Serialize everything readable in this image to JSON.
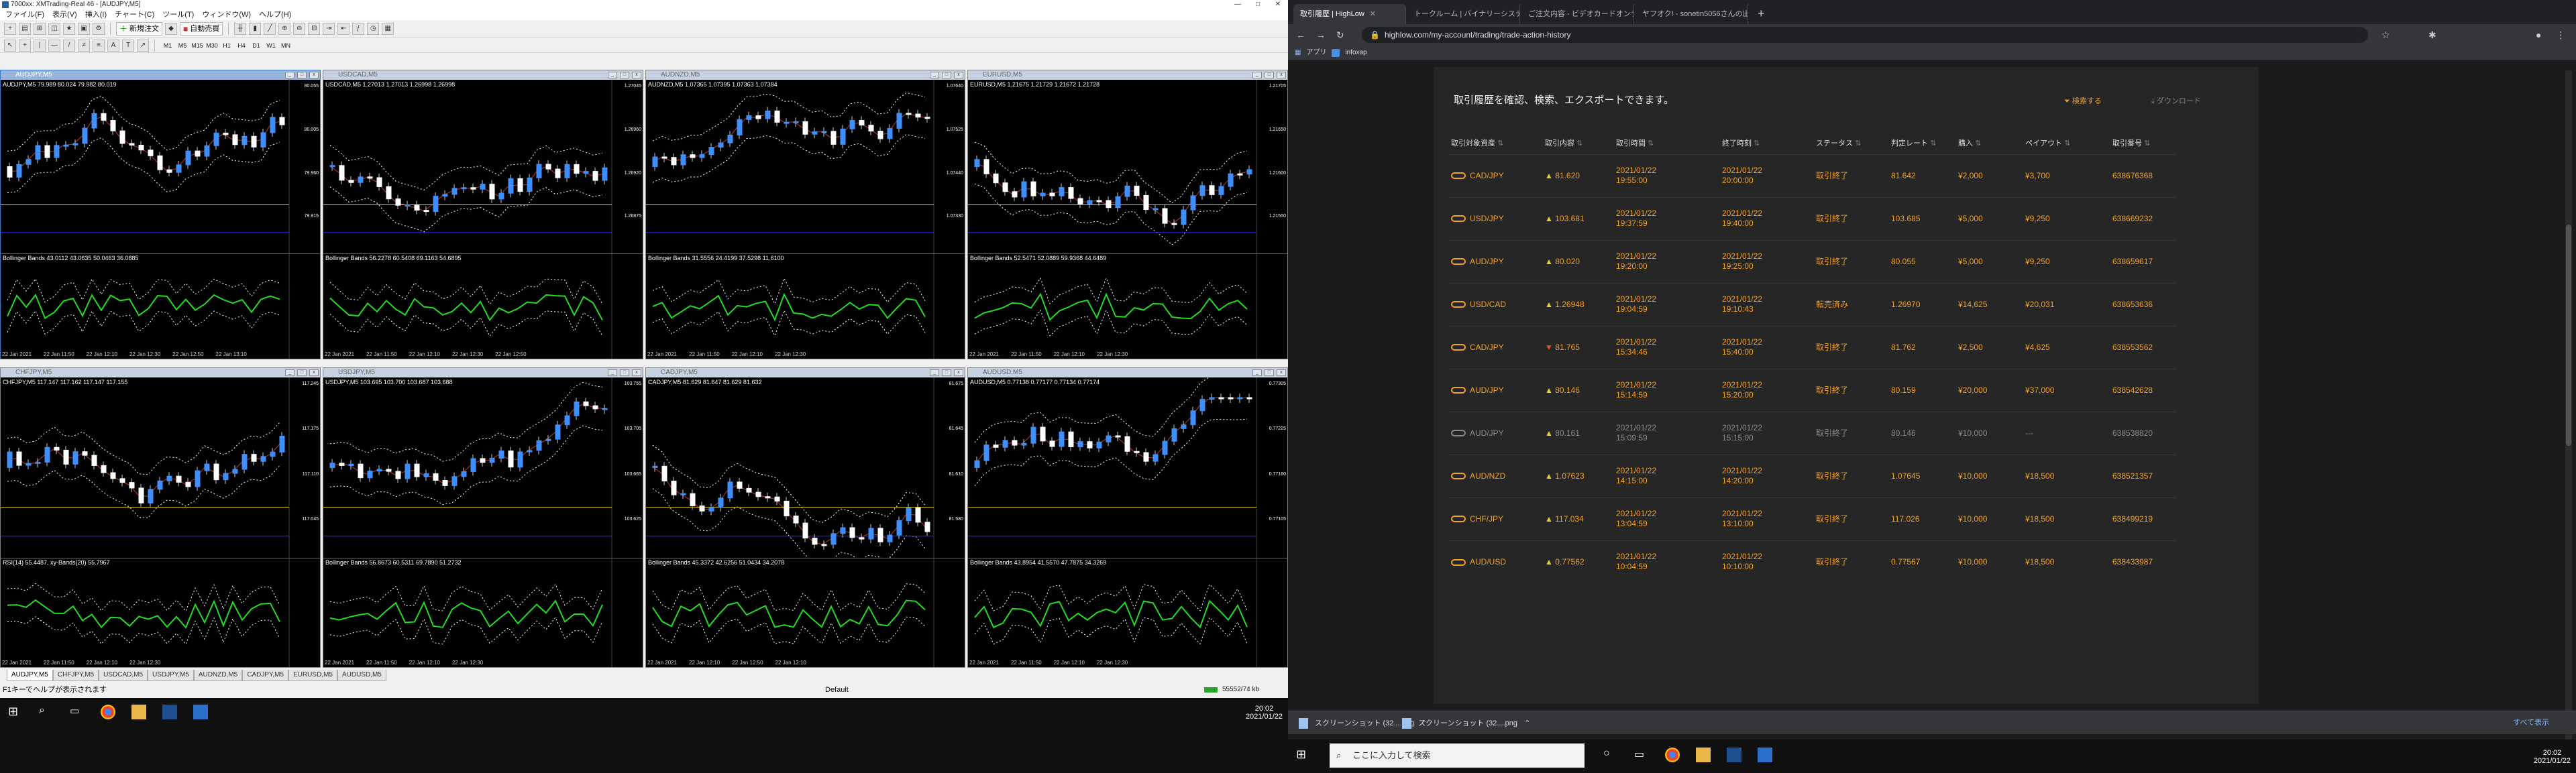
{
  "mt": {
    "title": "7000xx: XMTrading-Real 46 - [AUDJPY,M5]",
    "menu": [
      "ファイル(F)",
      "表示(V)",
      "挿入(I)",
      "チャート(C)",
      "ツール(T)",
      "ウィンドウ(W)",
      "ヘルプ(H)"
    ],
    "new_order": "新規注文",
    "auto_trade": "自動売買",
    "timeframes": [
      "M1",
      "M5",
      "M15",
      "M30",
      "H1",
      "H4",
      "D1",
      "W1",
      "MN"
    ],
    "status_left": "F1キーでヘルプが表示されます",
    "status_mid": "Default",
    "status_right": "55552/74 kb",
    "clock": [
      "20:02",
      "2021/01/22"
    ],
    "tabs": [
      "AUDJPY,M5",
      "CHFJPY,M5",
      "USDCAD,M5",
      "USDJPY,M5",
      "AUDNZD,M5",
      "CADJPY,M5",
      "EURUSD,M5",
      "AUDUSD,M5"
    ]
  },
  "charts": [
    {
      "title": "AUDJPY,M5",
      "info": "AUDJPY,M5  79.989 80.024 79.982 80.019",
      "sub": "Bollinger Bands 43.0112 43.0635 50.0463 36.0885",
      "prices": [
        "80.055",
        "80.005",
        "79.960",
        "79.915"
      ],
      "times": [
        "22 Jan 2021",
        "22 Jan 11:50",
        "22 Jan 12:10",
        "22 Jan 12:30",
        "22 Jan 12:50",
        "22 Jan 13:10"
      ]
    },
    {
      "title": "USDCAD,M5",
      "info": "USDCAD,M5  1.27013 1.27013 1.26998 1.26998",
      "sub": "Bollinger Bands 56.2278 60.5408 69.1163 54.6895",
      "prices": [
        "1.27045",
        "1.26960",
        "1.26920",
        "1.26875"
      ],
      "times": [
        "22 Jan 2021",
        "22 Jan 11:50",
        "22 Jan 12:10",
        "22 Jan 12:30",
        "22 Jan 12:50"
      ]
    },
    {
      "title": "AUDNZD,M5",
      "info": "AUDNZD,M5  1.07365 1.07395 1.07363 1.07384",
      "sub": "Bollinger Bands 31.5556 24.4199 37.5298 11.6100",
      "prices": [
        "1.07640",
        "1.07525",
        "1.07440",
        "1.07330"
      ],
      "times": [
        "22 Jan 2021",
        "22 Jan 11:50",
        "22 Jan 12:10",
        "22 Jan 12:30"
      ]
    },
    {
      "title": "EURUSD,M5",
      "info": "EURUSD,M5  1.21675 1.21729 1.21672 1.21728",
      "sub": "Bollinger Bands 52.5471 52.0889 59.9368 44.6489",
      "prices": [
        "1.21705",
        "1.21650",
        "1.21600",
        "1.21550"
      ],
      "times": [
        "22 Jan 2021",
        "22 Jan 11:50",
        "22 Jan 12:10",
        "22 Jan 12:30"
      ]
    },
    {
      "title": "CHFJPY,M5",
      "info": "CHFJPY,M5  117.147 117.162 117.147 117.155",
      "sub": "RSI(14) 55.4487, xy-Bands(20) 55.7967",
      "prices": [
        "117.245",
        "117.175",
        "117.110",
        "117.045"
      ],
      "times": [
        "22 Jan 2021",
        "22 Jan 11:50",
        "22 Jan 12:10",
        "22 Jan 12:30"
      ]
    },
    {
      "title": "USDJPY,M5",
      "info": "USDJPY,M5  103.695 103.700 103.687 103.688",
      "sub": "Bollinger Bands 56.8673 60.5311 69.7890 51.2732",
      "prices": [
        "103.755",
        "103.705",
        "103.665",
        "103.625"
      ],
      "times": [
        "22 Jan 2021",
        "22 Jan 11:50",
        "22 Jan 12:10",
        "22 Jan 12:30"
      ]
    },
    {
      "title": "CADJPY,M5",
      "info": "CADJPY,M5  81.629 81.647 81.629 81.632",
      "sub": "Bollinger Bands 45.3372 42.6256 51.0434 34.2078",
      "prices": [
        "81.675",
        "81.645",
        "81.610",
        "81.580"
      ],
      "times": [
        "22 Jan 2021",
        "22 Jan 12:10",
        "22 Jan 12:50",
        "22 Jan 13:10"
      ]
    },
    {
      "title": "AUDUSD,M5",
      "info": "AUDUSD,M5  0.77138 0.77177 0.77134 0.77174",
      "sub": "Bollinger Bands 43.8954 41.5570 47.7875 34.3269",
      "prices": [
        "0.77305",
        "0.77225",
        "0.77160",
        "0.77105"
      ],
      "times": [
        "22 Jan 2021",
        "22 Jan 11:50",
        "22 Jan 12:10",
        "22 Jan 12:30"
      ]
    }
  ],
  "browser": {
    "tabs": [
      "取引履歴 | HighLow",
      "トークルーム | バイナリーシステム改め",
      "ご注文内容 - ビデオカードオンライン",
      "ヤフオク! - sonetin5056さんの出品"
    ],
    "url": "highlow.com/my-account/trading/trade-action-history",
    "apps": "アプリ",
    "bookmark": "infoxap",
    "heading": "取引履歴を確認、検索、エクスポートできます。",
    "search_btn": "検索する",
    "download_btn": "ダウンロード",
    "columns": [
      "取引対象資産",
      "取引内容",
      "取引時間",
      "終了時刻",
      "ステータス",
      "判定レート",
      "購入",
      "ペイアウト",
      "取引番号"
    ],
    "rows": [
      {
        "asset": "CAD/JPY",
        "dir": "up",
        "rate": "81.620",
        "start": [
          "2021/01/22",
          "19:55:00"
        ],
        "end": [
          "2021/01/22",
          "20:00:00"
        ],
        "status": "取引終了",
        "judge": "81.642",
        "buy": "¥2,000",
        "payout": "¥3,700",
        "id": "638676368",
        "done": false
      },
      {
        "asset": "USD/JPY",
        "dir": "up",
        "rate": "103.681",
        "start": [
          "2021/01/22",
          "19:37:59"
        ],
        "end": [
          "2021/01/22",
          "19:40:00"
        ],
        "status": "取引終了",
        "judge": "103.685",
        "buy": "¥5,000",
        "payout": "¥9,250",
        "id": "638669232",
        "done": false
      },
      {
        "asset": "AUD/JPY",
        "dir": "up",
        "rate": "80.020",
        "start": [
          "2021/01/22",
          "19:20:00"
        ],
        "end": [
          "2021/01/22",
          "19:25:00"
        ],
        "status": "取引終了",
        "judge": "80.055",
        "buy": "¥5,000",
        "payout": "¥9,250",
        "id": "638659617",
        "done": false
      },
      {
        "asset": "USD/CAD",
        "dir": "up",
        "rate": "1.26948",
        "start": [
          "2021/01/22",
          "19:04:59"
        ],
        "end": [
          "2021/01/22",
          "19:10:43"
        ],
        "status": "転売済み",
        "judge": "1.26970",
        "buy": "¥14,625",
        "payout": "¥20,031",
        "id": "638653636",
        "done": false
      },
      {
        "asset": "CAD/JPY",
        "dir": "down",
        "rate": "81.765",
        "start": [
          "2021/01/22",
          "15:34:46"
        ],
        "end": [
          "2021/01/22",
          "15:40:00"
        ],
        "status": "取引終了",
        "judge": "81.762",
        "buy": "¥2,500",
        "payout": "¥4,625",
        "id": "638553562",
        "done": false
      },
      {
        "asset": "AUD/JPY",
        "dir": "up",
        "rate": "80.146",
        "start": [
          "2021/01/22",
          "15:14:59"
        ],
        "end": [
          "2021/01/22",
          "15:20:00"
        ],
        "status": "取引終了",
        "judge": "80.159",
        "buy": "¥20,000",
        "payout": "¥37,000",
        "id": "638542628",
        "done": false
      },
      {
        "asset": "AUD/JPY",
        "dir": "up",
        "rate": "80.161",
        "start": [
          "2021/01/22",
          "15:09:59"
        ],
        "end": [
          "2021/01/22",
          "15:15:00"
        ],
        "status": "取引終了",
        "judge": "80.146",
        "buy": "¥10,000",
        "payout": "---",
        "id": "638538820",
        "done": true
      },
      {
        "asset": "AUD/NZD",
        "dir": "up",
        "rate": "1.07623",
        "start": [
          "2021/01/22",
          "14:15:00"
        ],
        "end": [
          "2021/01/22",
          "14:20:00"
        ],
        "status": "取引終了",
        "judge": "1.07645",
        "buy": "¥10,000",
        "payout": "¥18,500",
        "id": "638521357",
        "done": false
      },
      {
        "asset": "CHF/JPY",
        "dir": "up",
        "rate": "117.034",
        "start": [
          "2021/01/22",
          "13:04:59"
        ],
        "end": [
          "2021/01/22",
          "13:10:00"
        ],
        "status": "取引終了",
        "judge": "117.026",
        "buy": "¥10,000",
        "payout": "¥18,500",
        "id": "638499219",
        "done": false
      },
      {
        "asset": "AUD/USD",
        "dir": "up",
        "rate": "0.77562",
        "start": [
          "2021/01/22",
          "10:04:59"
        ],
        "end": [
          "2021/01/22",
          "10:10:00"
        ],
        "status": "取引終了",
        "judge": "0.77567",
        "buy": "¥10,000",
        "payout": "¥18,500",
        "id": "638433987",
        "done": false
      }
    ],
    "downloads": [
      "スクリーンショット (32....png",
      "スクリーンショット (32....png"
    ],
    "show_all": "すべて表示",
    "search_placeholder": "ここに入力して検索",
    "clock": [
      "20:02",
      "2021/01/22"
    ]
  }
}
